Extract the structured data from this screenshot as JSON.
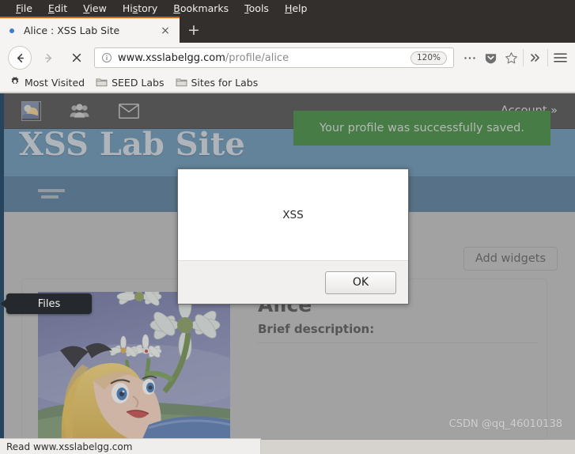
{
  "browser": {
    "menus": [
      {
        "label": "File",
        "accel": "F"
      },
      {
        "label": "Edit",
        "accel": "E"
      },
      {
        "label": "View",
        "accel": "V"
      },
      {
        "label": "History",
        "accel": "s"
      },
      {
        "label": "Bookmarks",
        "accel": "B"
      },
      {
        "label": "Tools",
        "accel": "T"
      },
      {
        "label": "Help",
        "accel": "H"
      }
    ],
    "tab": {
      "title": "Alice : XSS Lab Site",
      "close_label": "×",
      "new_tab_label": "+"
    },
    "toolbar": {
      "back_icon": "arrow-left-icon",
      "forward_icon": "arrow-right-icon",
      "stop_icon": "stop-x-icon",
      "info_icon": "page-info-icon",
      "url_host": "www.xsslabelgg.com",
      "url_path": "/profile/alice",
      "url_full": "www.xsslabelgg.com/profile/alice",
      "zoom_level": "120%",
      "more_icon": "ellipsis-icon",
      "pocket_icon": "pocket-shield-icon",
      "bookmark_icon": "star-icon",
      "overflow_icon": "chevron-double-right-icon",
      "menu_icon": "hamburger-menu-icon"
    },
    "bookmarks": [
      {
        "label": "Most Visited",
        "icon": "gear-icon"
      },
      {
        "label": "SEED Labs",
        "icon": "folder-icon"
      },
      {
        "label": "Sites for Labs",
        "icon": "folder-icon"
      }
    ],
    "statusbar": {
      "text": "Read www.xsslabelgg.com"
    }
  },
  "site": {
    "topbar": {
      "avatar_icon": "user-avatar-thumbnail",
      "friends_icon": "friends-group-icon",
      "mail_icon": "envelope-icon",
      "account_label": "Account »"
    },
    "title": "XSS Lab Site",
    "success_message": "Your profile was successfully saved.",
    "tooltip": {
      "label": "Files"
    },
    "nav_icon": "menu-lines-icon",
    "add_widgets_label": "Add widgets",
    "profile": {
      "name": "Alice",
      "brief_description_label": "Brief description:",
      "photo_icon": "alice-profile-photo",
      "description_value": ""
    }
  },
  "alert": {
    "message": "XSS",
    "ok_label": "OK"
  },
  "watermark": "CSDN @qq_46010138",
  "colors": {
    "chrome_dark": "#332f2c",
    "tab_accent": "#e66000",
    "site_header_blue": "#5384a8",
    "site_nav_blue": "#426a8c",
    "topbar_dark": "#3b3b3b",
    "success_green": "#2a7a2a",
    "left_border": "#27445e"
  }
}
